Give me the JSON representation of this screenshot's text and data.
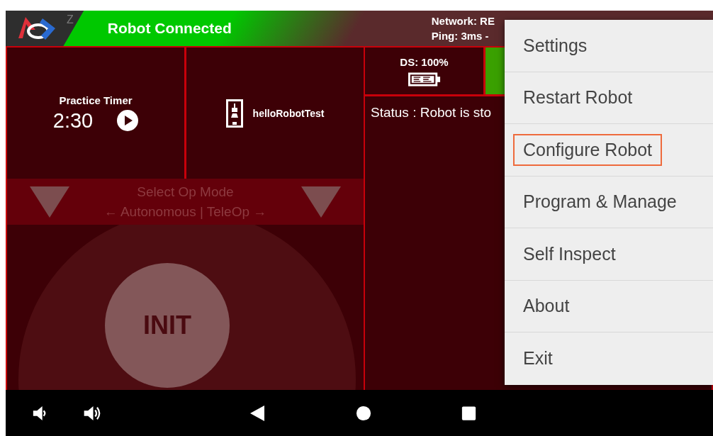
{
  "top_bar": {
    "logo_badge": "Z",
    "status": "Robot Connected",
    "network": "Network: RE",
    "ping": "Ping: 3ms -"
  },
  "timer": {
    "label": "Practice Timer",
    "time": "2:30"
  },
  "active_opmode": {
    "name": "helloRobotTest"
  },
  "opmode_selector": {
    "title": "Select Op Mode",
    "hint": "← Autonomous | TeleOp →"
  },
  "init_button": {
    "label": "INIT"
  },
  "ds_battery": {
    "label": "DS: 100%"
  },
  "status": {
    "text": "Status : Robot is sto"
  },
  "menu": {
    "items": [
      {
        "label": "Settings",
        "selected": false
      },
      {
        "label": "Restart Robot",
        "selected": false
      },
      {
        "label": "Configure Robot",
        "selected": true
      },
      {
        "label": "Program & Manage",
        "selected": false
      },
      {
        "label": "Self Inspect",
        "selected": false
      },
      {
        "label": "About",
        "selected": false
      },
      {
        "label": "Exit",
        "selected": false
      }
    ]
  }
}
